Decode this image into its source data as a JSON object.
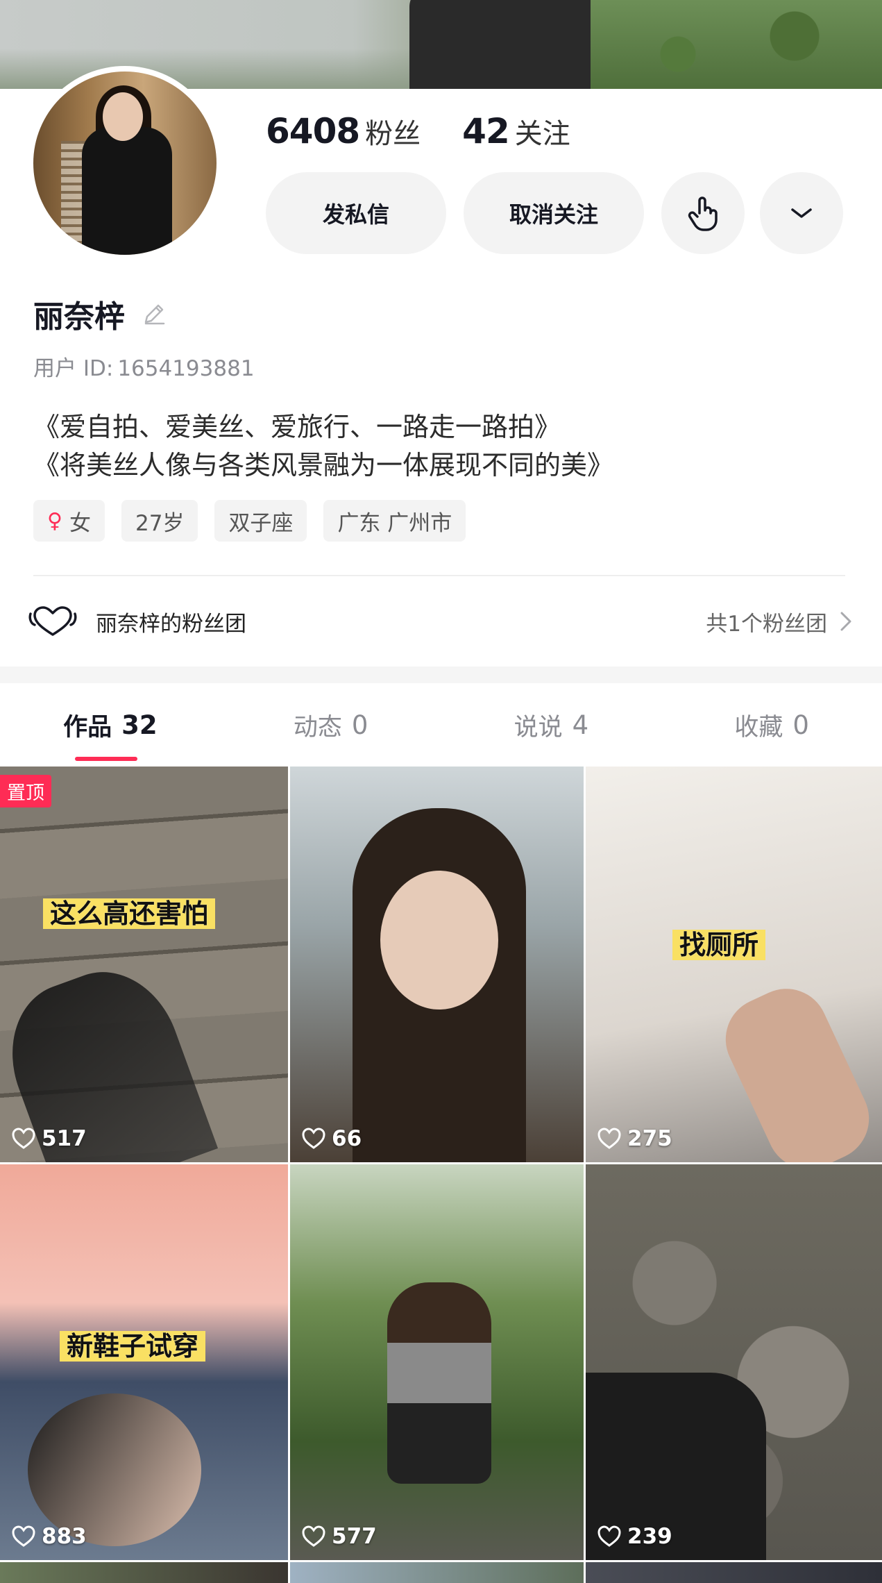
{
  "profile": {
    "name": "丽奈梓",
    "user_id_label": "用户 ID:",
    "user_id": "1654193881",
    "stats": {
      "fans_count": "6408",
      "fans_label": "粉丝",
      "following_count": "42",
      "following_label": "关注"
    },
    "bio_lines": [
      "《爱自拍、爱美丝、爱旅行、一路走一路拍》",
      "《将美丝人像与各类风景融为一体展现不同的美》"
    ],
    "tags": {
      "gender": "女",
      "age": "27岁",
      "zodiac": "双子座",
      "location": "广东 广州市"
    }
  },
  "actions": {
    "message": "发私信",
    "unfollow": "取消关注",
    "poke_icon": "hand-tap-icon",
    "more_icon": "chevron-down-icon"
  },
  "fanclub": {
    "label": "丽奈梓的粉丝团",
    "count_text": "共1个粉丝团"
  },
  "tabs": [
    {
      "label": "作品",
      "count": "32",
      "active": true
    },
    {
      "label": "动态",
      "count": "0",
      "active": false
    },
    {
      "label": "说说",
      "count": "4",
      "active": false
    },
    {
      "label": "收藏",
      "count": "0",
      "active": false
    }
  ],
  "pin_label": "置顶",
  "videos": [
    {
      "caption": "这么高还害怕",
      "likes": "517",
      "pinned": true
    },
    {
      "caption": "",
      "likes": "66",
      "pinned": false
    },
    {
      "caption": "找厕所",
      "likes": "275",
      "pinned": false
    },
    {
      "caption": "新鞋子试穿",
      "likes": "883",
      "pinned": false
    },
    {
      "caption": "",
      "likes": "577",
      "pinned": false
    },
    {
      "caption": "",
      "likes": "239",
      "pinned": false
    }
  ],
  "colors": {
    "accent": "#fe2c55",
    "caption_bg": "#f9e063",
    "button_bg": "#f3f3f3"
  }
}
